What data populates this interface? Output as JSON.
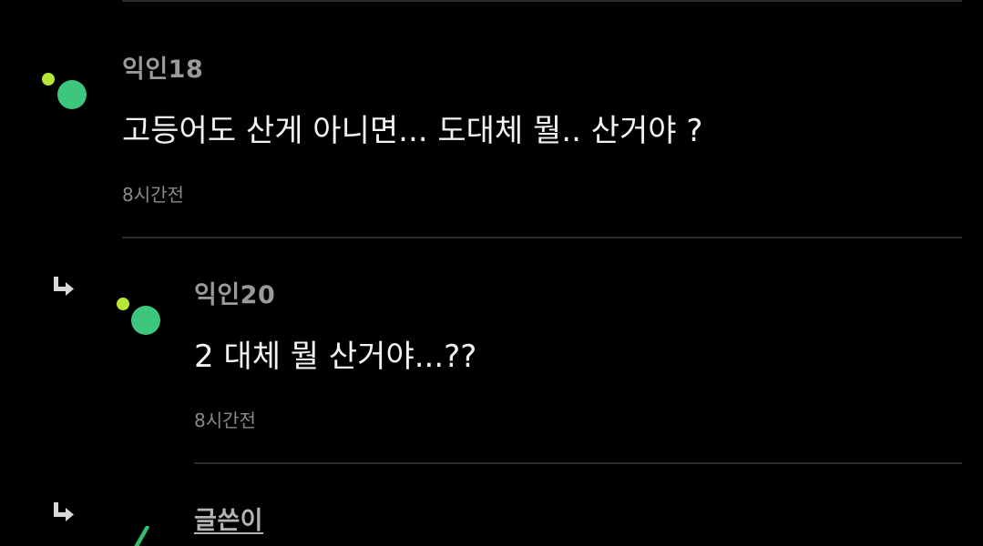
{
  "comments": [
    {
      "nickname": "익인18",
      "text": "고등어도 산게 아니면... 도대체 뭘.. 산거야 ?",
      "time": "8시간전",
      "is_reply": false
    },
    {
      "nickname": "익인20",
      "text": "2 대체 뭘 산거야...??",
      "time": "8시간전",
      "is_reply": true
    },
    {
      "nickname": "글쓴이",
      "is_reply": true,
      "is_author": true
    }
  ],
  "icons": {
    "reply": "reply-arrow-icon",
    "avatar": "anonymous-avatar-icon"
  },
  "colors": {
    "background": "#000000",
    "avatar_small_dot": "#b6e636",
    "avatar_big_dot": "#3ec77c",
    "author_mark": "#2fbf6e",
    "divider": "#2a2a2a"
  }
}
